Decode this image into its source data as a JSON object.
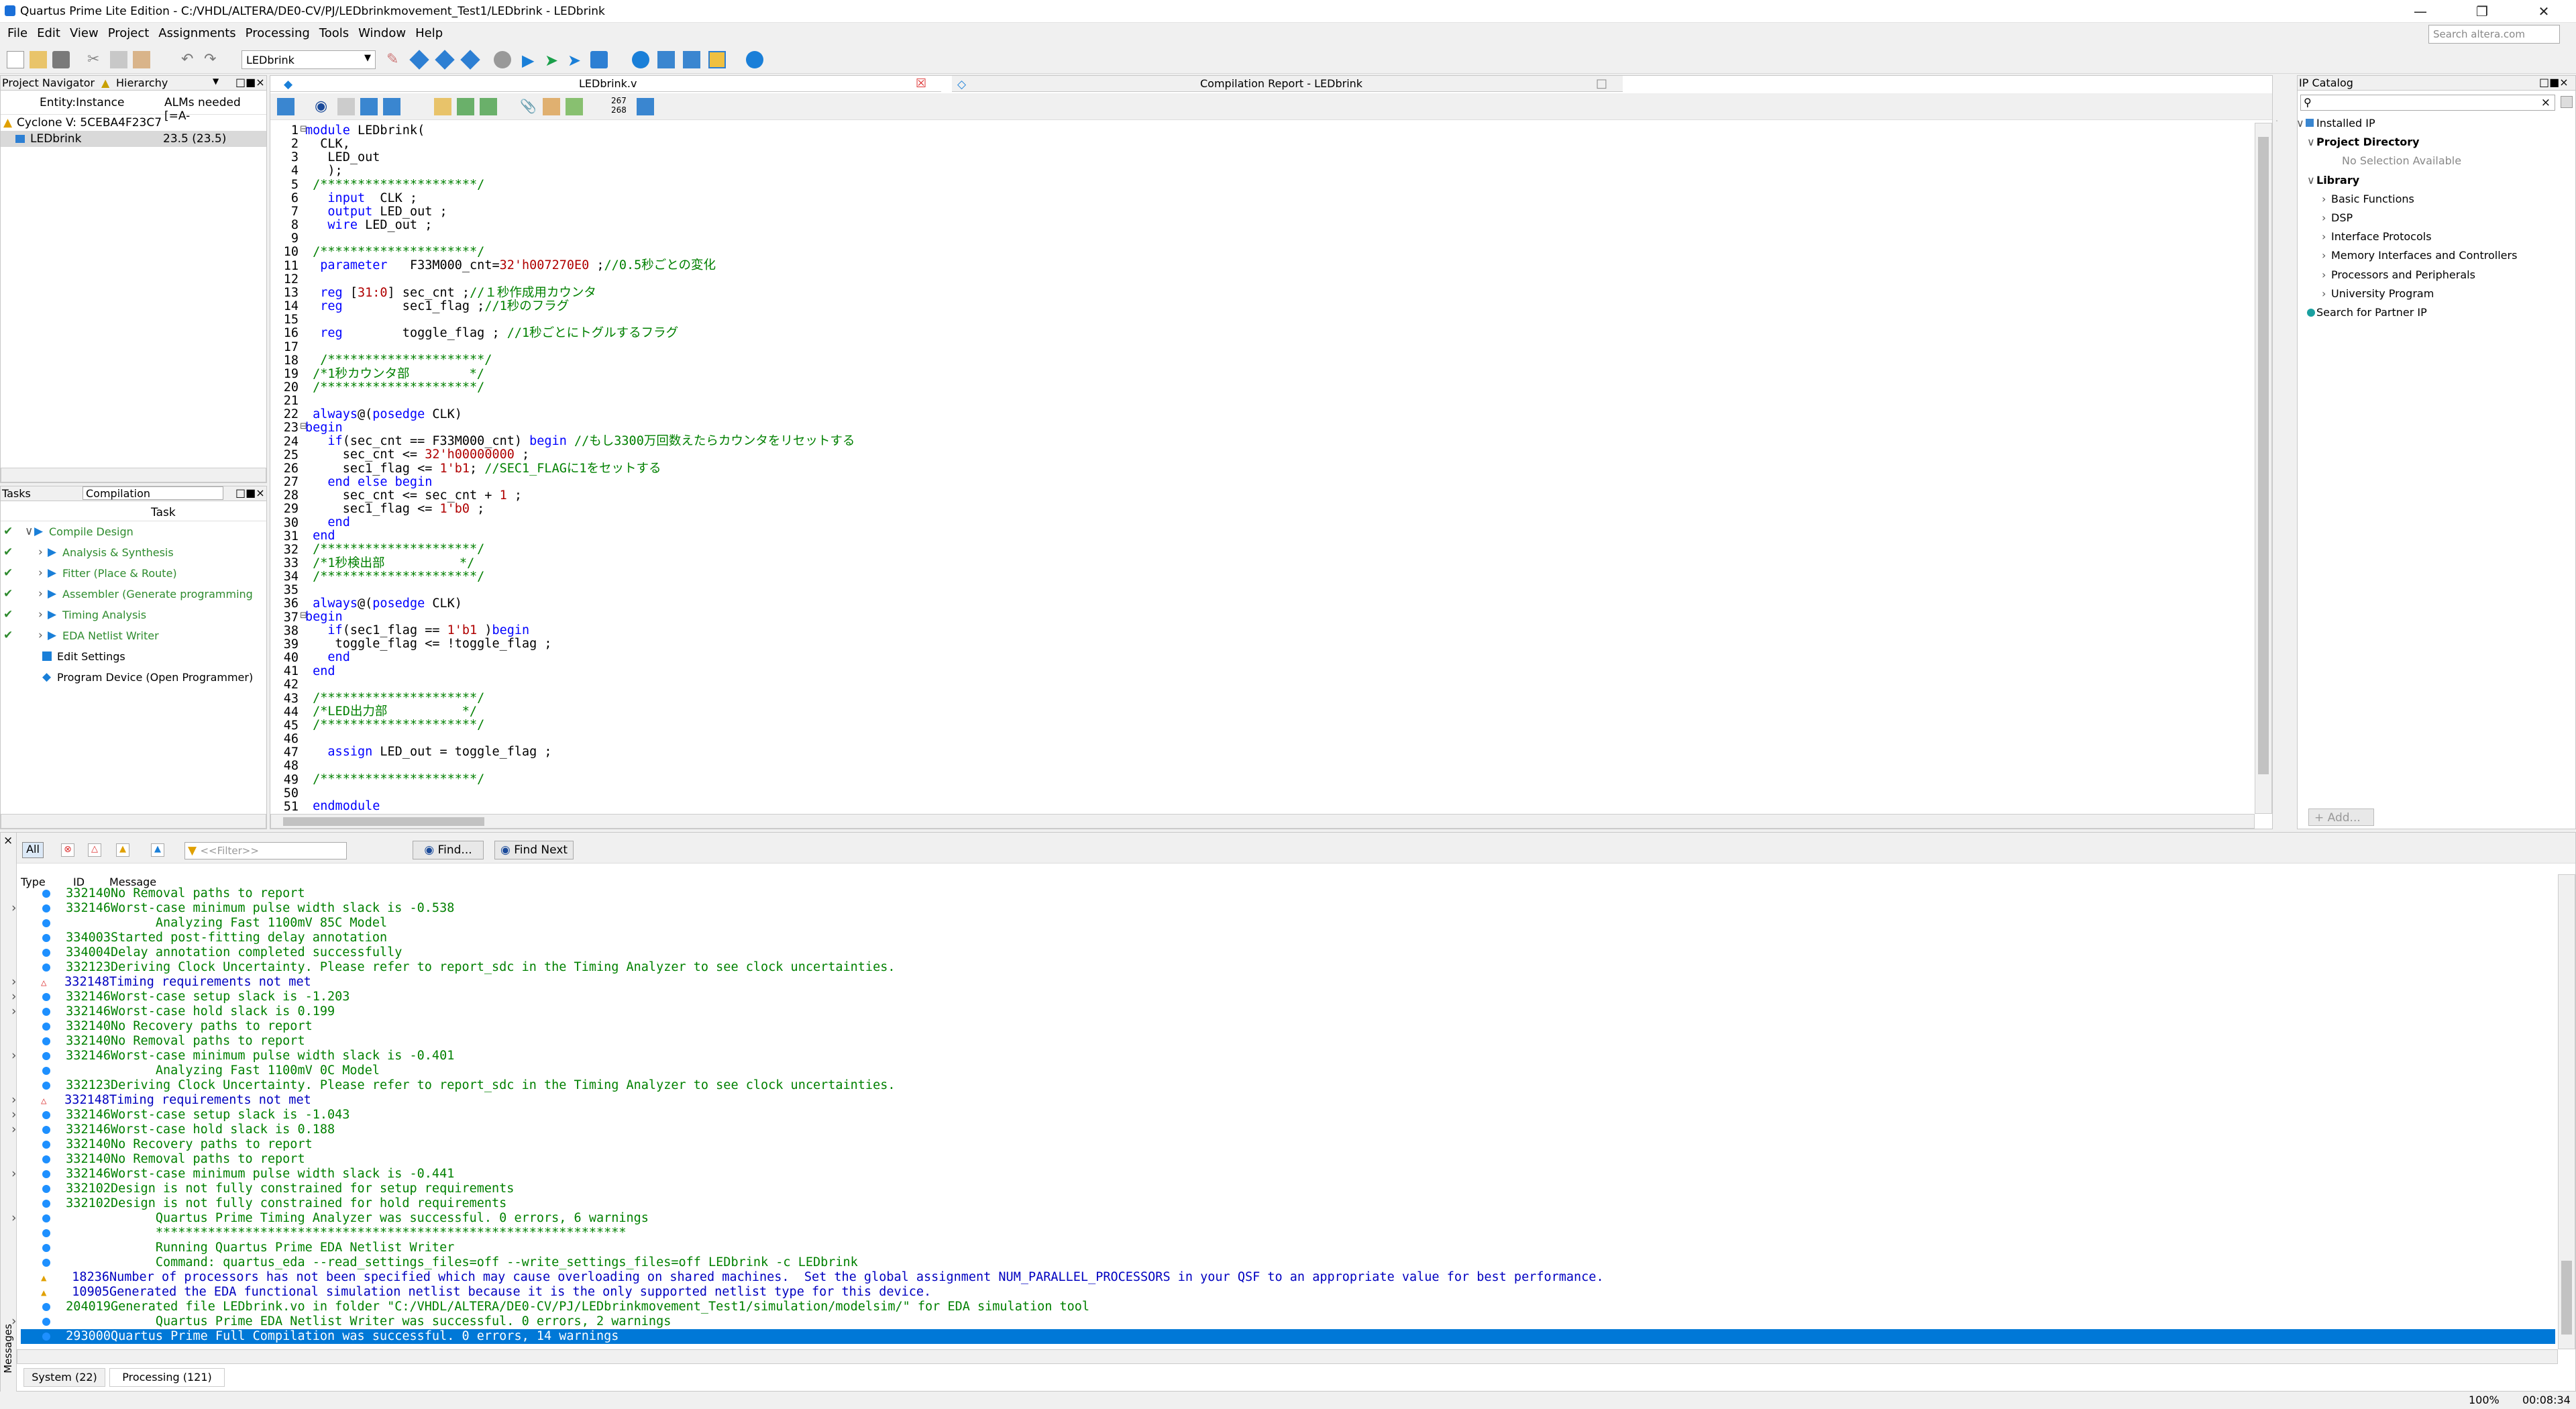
{
  "window": {
    "title": "Quartus Prime Lite Edition - C:/VHDL/ALTERA/DE0-CV/PJ/LEDbrinkmovement_Test1/LEDbrink - LEDbrink",
    "search_placeholder": "Search altera.com"
  },
  "menu": [
    "File",
    "Edit",
    "View",
    "Project",
    "Assignments",
    "Processing",
    "Tools",
    "Window",
    "Help"
  ],
  "toolbar": {
    "project": "LEDbrink"
  },
  "navigator": {
    "title": "Project Navigator",
    "view": "Hierarchy",
    "col1": "Entity:Instance",
    "col2": "ALMs needed [=A-",
    "device": "Cyclone V: 5CEBA4F23C7",
    "entity": "LEDbrink",
    "alms": "23.5 (23.5)"
  },
  "tasks": {
    "title": "Tasks",
    "flow": "Compilation",
    "col": "Task",
    "items": [
      {
        "label": "Compile Design",
        "check": true,
        "level": 0
      },
      {
        "label": "Analysis & Synthesis",
        "check": true,
        "level": 1
      },
      {
        "label": "Fitter (Place & Route)",
        "check": true,
        "level": 1
      },
      {
        "label": "Assembler (Generate programming",
        "check": true,
        "level": 1
      },
      {
        "label": "Timing Analysis",
        "check": true,
        "level": 1
      },
      {
        "label": "EDA Netlist Writer",
        "check": true,
        "level": 1
      },
      {
        "label": "Edit Settings",
        "check": false,
        "level": 0
      },
      {
        "label": "Program Device (Open Programmer)",
        "check": false,
        "level": 0
      }
    ]
  },
  "editor": {
    "tab1": "LEDbrink.v",
    "tab2": "Compilation Report - LEDbrink",
    "line_hint": "267\n268",
    "lines": [
      {
        "n": "1",
        "t": [
          [
            "kw",
            "module"
          ],
          [
            "tx",
            " LEDbrink("
          ]
        ]
      },
      {
        "n": "2",
        "t": [
          [
            "tx",
            "  CLK,"
          ]
        ]
      },
      {
        "n": "3",
        "t": [
          [
            "tx",
            "   LED_out"
          ]
        ]
      },
      {
        "n": "4",
        "t": [
          [
            "tx",
            "   );"
          ]
        ]
      },
      {
        "n": "5",
        "t": [
          [
            "cm",
            " /*********************/"
          ]
        ]
      },
      {
        "n": "6",
        "t": [
          [
            "kw",
            "   input"
          ],
          [
            "tx",
            "  CLK ;"
          ]
        ]
      },
      {
        "n": "7",
        "t": [
          [
            "kw",
            "   output"
          ],
          [
            "tx",
            " LED_out ;"
          ]
        ]
      },
      {
        "n": "8",
        "t": [
          [
            "kw",
            "   wire"
          ],
          [
            "tx",
            " LED_out ;"
          ]
        ]
      },
      {
        "n": "9",
        "t": [
          [
            "tx",
            ""
          ]
        ]
      },
      {
        "n": "10",
        "t": [
          [
            "cm",
            " /*********************/"
          ]
        ]
      },
      {
        "n": "11",
        "t": [
          [
            "kw",
            "  parameter"
          ],
          [
            "tx",
            "   F33M000_cnt="
          ],
          [
            "num",
            "32'h007270E0"
          ],
          [
            "tx",
            " ;"
          ],
          [
            "cm",
            "//0.5秒ごとの変化"
          ]
        ]
      },
      {
        "n": "12",
        "t": [
          [
            "tx",
            ""
          ]
        ]
      },
      {
        "n": "13",
        "t": [
          [
            "kw",
            "  reg"
          ],
          [
            "tx",
            " ["
          ],
          [
            "num",
            "31:0"
          ],
          [
            "tx",
            "] sec_cnt ;"
          ],
          [
            "cm",
            "//１秒作成用カウンタ"
          ]
        ]
      },
      {
        "n": "14",
        "t": [
          [
            "kw",
            "  reg"
          ],
          [
            "tx",
            "        sec1_flag ;"
          ],
          [
            "cm",
            "//1秒のフラグ"
          ]
        ]
      },
      {
        "n": "15",
        "t": [
          [
            "tx",
            ""
          ]
        ]
      },
      {
        "n": "16",
        "t": [
          [
            "kw",
            "  reg"
          ],
          [
            "tx",
            "        toggle_flag ; "
          ],
          [
            "cm",
            "//1秒ごとにトグルするフラグ"
          ]
        ]
      },
      {
        "n": "17",
        "t": [
          [
            "tx",
            ""
          ]
        ]
      },
      {
        "n": "18",
        "t": [
          [
            "cm",
            "  /*********************/"
          ]
        ]
      },
      {
        "n": "19",
        "t": [
          [
            "cm",
            " /*1秒カウンタ部        */"
          ]
        ]
      },
      {
        "n": "20",
        "t": [
          [
            "cm",
            " /*********************/"
          ]
        ]
      },
      {
        "n": "21",
        "t": [
          [
            "tx",
            ""
          ]
        ]
      },
      {
        "n": "22",
        "t": [
          [
            "kw",
            " always"
          ],
          [
            "tx",
            "@("
          ],
          [
            "kw",
            "posedge"
          ],
          [
            "tx",
            " CLK)"
          ]
        ]
      },
      {
        "n": "23",
        "t": [
          [
            "kw",
            "begin"
          ]
        ]
      },
      {
        "n": "24",
        "t": [
          [
            "kw",
            "   if"
          ],
          [
            "tx",
            "(sec_cnt == F33M000_cnt) "
          ],
          [
            "kw",
            "begin"
          ],
          [
            "tx",
            " "
          ],
          [
            "cm",
            "//もし3300万回数えたらカウンタをリセットする"
          ]
        ]
      },
      {
        "n": "25",
        "t": [
          [
            "tx",
            "     sec_cnt <= "
          ],
          [
            "num",
            "32'h00000000"
          ],
          [
            "tx",
            " ;"
          ]
        ]
      },
      {
        "n": "26",
        "t": [
          [
            "tx",
            "     sec1_flag <= "
          ],
          [
            "num",
            "1'b1"
          ],
          [
            "tx",
            "; "
          ],
          [
            "cm",
            "//SEC1_FLAGに1をセットする"
          ]
        ]
      },
      {
        "n": "27",
        "t": [
          [
            "kw",
            "   end else begin"
          ]
        ]
      },
      {
        "n": "28",
        "t": [
          [
            "tx",
            "     sec_cnt <= sec_cnt + "
          ],
          [
            "num",
            "1"
          ],
          [
            "tx",
            " ;"
          ]
        ]
      },
      {
        "n": "29",
        "t": [
          [
            "tx",
            "     sec1_flag <= "
          ],
          [
            "num",
            "1'b0"
          ],
          [
            "tx",
            " ;"
          ]
        ]
      },
      {
        "n": "30",
        "t": [
          [
            "kw",
            "   end"
          ]
        ]
      },
      {
        "n": "31",
        "t": [
          [
            "kw",
            " end"
          ]
        ]
      },
      {
        "n": "32",
        "t": [
          [
            "cm",
            " /*********************/"
          ]
        ]
      },
      {
        "n": "33",
        "t": [
          [
            "cm",
            " /*1秒検出部          */"
          ]
        ]
      },
      {
        "n": "34",
        "t": [
          [
            "cm",
            " /*********************/"
          ]
        ]
      },
      {
        "n": "35",
        "t": [
          [
            "tx",
            ""
          ]
        ]
      },
      {
        "n": "36",
        "t": [
          [
            "kw",
            " always"
          ],
          [
            "tx",
            "@("
          ],
          [
            "kw",
            "posedge"
          ],
          [
            "tx",
            " CLK)"
          ]
        ]
      },
      {
        "n": "37",
        "t": [
          [
            "kw",
            "begin"
          ]
        ]
      },
      {
        "n": "38",
        "t": [
          [
            "kw",
            "   if"
          ],
          [
            "tx",
            "(sec1_flag == "
          ],
          [
            "num",
            "1'b1"
          ],
          [
            "tx",
            " )"
          ],
          [
            "kw",
            "begin"
          ]
        ]
      },
      {
        "n": "39",
        "t": [
          [
            "tx",
            "    toggle_flag <= !toggle_flag ;"
          ]
        ]
      },
      {
        "n": "40",
        "t": [
          [
            "kw",
            "   end"
          ]
        ]
      },
      {
        "n": "41",
        "t": [
          [
            "kw",
            " end"
          ]
        ]
      },
      {
        "n": "42",
        "t": [
          [
            "tx",
            ""
          ]
        ]
      },
      {
        "n": "43",
        "t": [
          [
            "cm",
            " /*********************/"
          ]
        ]
      },
      {
        "n": "44",
        "t": [
          [
            "cm",
            " /*LED出力部          */"
          ]
        ]
      },
      {
        "n": "45",
        "t": [
          [
            "cm",
            " /*********************/"
          ]
        ]
      },
      {
        "n": "46",
        "t": [
          [
            "tx",
            ""
          ]
        ]
      },
      {
        "n": "47",
        "t": [
          [
            "kw",
            "   assign"
          ],
          [
            "tx",
            " LED_out = toggle_flag ;"
          ]
        ]
      },
      {
        "n": "48",
        "t": [
          [
            "tx",
            ""
          ]
        ]
      },
      {
        "n": "49",
        "t": [
          [
            "cm",
            " /*********************/"
          ]
        ]
      },
      {
        "n": "50",
        "t": [
          [
            "tx",
            ""
          ]
        ]
      },
      {
        "n": "51",
        "t": [
          [
            "kw",
            " endmodule"
          ]
        ]
      }
    ]
  },
  "ipcatalog": {
    "title": "IP Catalog",
    "installed": "Installed IP",
    "project_dir": "Project Directory",
    "no_sel": "No Selection Available",
    "library": "Library",
    "items": [
      "Basic Functions",
      "DSP",
      "Interface Protocols",
      "Memory Interfaces and Controllers",
      "Processors and Peripherals",
      "University Program"
    ],
    "partner": "Search for Partner IP",
    "add": "+ Add..."
  },
  "messages": {
    "filter_all": "All",
    "filter_placeholder": "<<Filter>>",
    "find": "Find...",
    "find_next": "Find Next",
    "col_type": "Type",
    "col_id": "ID",
    "col_msg": "Message",
    "side_label": "Messages",
    "tab_system": "System (22)",
    "tab_processing": "Processing (121)",
    "rows": [
      {
        "k": "i",
        "id": "332140",
        "m": "No Removal paths to report"
      },
      {
        "k": "i",
        "id": "332146",
        "m": "Worst-case minimum pulse width slack is -0.538",
        "e": true
      },
      {
        "k": "i",
        "id": "",
        "m": "      Analyzing Fast 1100mV 85C Model"
      },
      {
        "k": "i",
        "id": "334003",
        "m": "Started post-fitting delay annotation"
      },
      {
        "k": "i",
        "id": "334004",
        "m": "Delay annotation completed successfully"
      },
      {
        "k": "i",
        "id": "332123",
        "m": "Deriving Clock Uncertainty. Please refer to report_sdc in the Timing Analyzer to see clock uncertainties."
      },
      {
        "k": "c",
        "id": "332148",
        "m": "Timing requirements not met",
        "e": true
      },
      {
        "k": "i",
        "id": "332146",
        "m": "Worst-case setup slack is -1.203",
        "e": true
      },
      {
        "k": "i",
        "id": "332146",
        "m": "Worst-case hold slack is 0.199",
        "e": true
      },
      {
        "k": "i",
        "id": "332140",
        "m": "No Recovery paths to report"
      },
      {
        "k": "i",
        "id": "332140",
        "m": "No Removal paths to report"
      },
      {
        "k": "i",
        "id": "332146",
        "m": "Worst-case minimum pulse width slack is -0.401",
        "e": true
      },
      {
        "k": "i",
        "id": "",
        "m": "      Analyzing Fast 1100mV 0C Model"
      },
      {
        "k": "i",
        "id": "332123",
        "m": "Deriving Clock Uncertainty. Please refer to report_sdc in the Timing Analyzer to see clock uncertainties."
      },
      {
        "k": "c",
        "id": "332148",
        "m": "Timing requirements not met",
        "e": true
      },
      {
        "k": "i",
        "id": "332146",
        "m": "Worst-case setup slack is -1.043",
        "e": true
      },
      {
        "k": "i",
        "id": "332146",
        "m": "Worst-case hold slack is 0.188",
        "e": true
      },
      {
        "k": "i",
        "id": "332140",
        "m": "No Recovery paths to report"
      },
      {
        "k": "i",
        "id": "332140",
        "m": "No Removal paths to report"
      },
      {
        "k": "i",
        "id": "332146",
        "m": "Worst-case minimum pulse width slack is -0.441",
        "e": true
      },
      {
        "k": "i",
        "id": "332102",
        "m": "Design is not fully constrained for setup requirements"
      },
      {
        "k": "i",
        "id": "332102",
        "m": "Design is not fully constrained for hold requirements"
      },
      {
        "k": "i",
        "id": "",
        "m": "      Quartus Prime Timing Analyzer was successful. 0 errors, 6 warnings",
        "e": true
      },
      {
        "k": "i",
        "id": "",
        "m": "      ***************************************************************"
      },
      {
        "k": "i",
        "id": "",
        "m": "      Running Quartus Prime EDA Netlist Writer"
      },
      {
        "k": "i",
        "id": "",
        "m": "      Command: quartus_eda --read_settings_files=off --write_settings_files=off LEDbrink -c LEDbrink"
      },
      {
        "k": "w",
        "id": "18236",
        "m": "Number of processors has not been specified which may cause overloading on shared machines.  Set the global assignment NUM_PARALLEL_PROCESSORS in your QSF to an appropriate value for best performance."
      },
      {
        "k": "w",
        "id": "10905",
        "m": "Generated the EDA functional simulation netlist because it is the only supported netlist type for this device."
      },
      {
        "k": "i",
        "id": "204019",
        "m": "Generated file LEDbrink.vo in folder \"C:/VHDL/ALTERA/DE0-CV/PJ/LEDbrinkmovement_Test1/simulation/modelsim/\" for EDA simulation tool"
      },
      {
        "k": "i",
        "id": "",
        "m": "      Quartus Prime EDA Netlist Writer was successful. 0 errors, 2 warnings",
        "e": true
      },
      {
        "k": "i",
        "id": "293000",
        "m": "Quartus Prime Full Compilation was successful. 0 errors, 14 warnings",
        "sel": true
      }
    ]
  },
  "status": {
    "zoom": "100%",
    "time": "00:08:34"
  },
  "colors": {
    "accent": "#0078d7",
    "info": "#1e90ff",
    "code_kw": "#0000ff",
    "code_cm": "#008000",
    "msg_green": "#008000",
    "msg_warn": "#0000c0",
    "check": "#2e8b2e"
  }
}
